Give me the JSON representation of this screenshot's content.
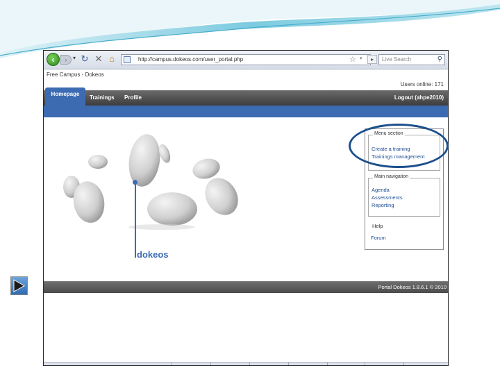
{
  "browser": {
    "url": "http://campus.dokeos.com/user_portal.php",
    "search_placeholder": "Live Search",
    "back_icon": "back-arrow-icon",
    "forward_icon": "forward-arrow-icon",
    "refresh_icon": "refresh-icon",
    "stop_icon": "stop-icon",
    "home_icon": "home-icon",
    "search_icon": "magnifier-icon"
  },
  "site": {
    "title": "Free Campus - Dokeos",
    "users_online": "Users online: 171"
  },
  "menu": {
    "tabs": [
      {
        "label": "Homepage"
      },
      {
        "label": "Trainings"
      },
      {
        "label": "Profile"
      }
    ],
    "logout": "Logout (ahpe2010)"
  },
  "logo": {
    "text": "dokeos"
  },
  "sidebar": {
    "menu_section": {
      "legend": "Menu section",
      "links": [
        "Create a training",
        "Trainings management"
      ]
    },
    "main_navigation": {
      "legend": "Main navigation",
      "links": [
        "Agenda",
        "Assessments",
        "Reporting"
      ]
    },
    "help": {
      "title": "Help",
      "links": [
        "Forum"
      ]
    }
  },
  "footer": {
    "text": "Portal Dokeos 1.8.6.1 © 2010"
  },
  "colors": {
    "accent_blue": "#3c6bb2",
    "highlight_oval": "#1c4f8c",
    "menubar_gray": "#4a4a4a"
  }
}
